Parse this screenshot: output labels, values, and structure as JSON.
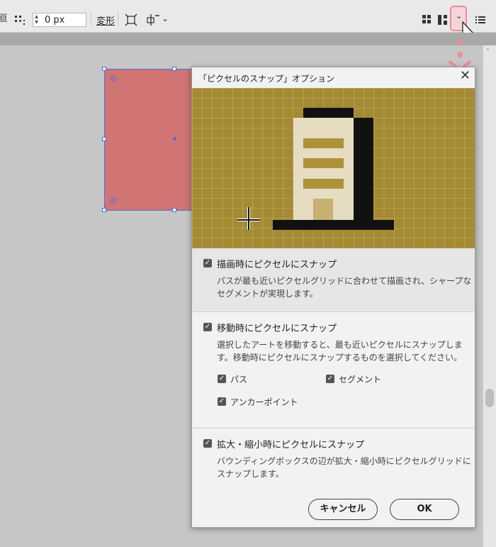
{
  "toolbar": {
    "left_glyph": "亘",
    "pixel_align_icon": "pixel-align-icon",
    "offset_value": "0 px",
    "transform_label": "変形",
    "transform_icon": "transform-bounding-icon",
    "align_icon": "align-anchor-icon",
    "dropdown_chevron": "⌄",
    "grid_icon": "pixel-grid-icon",
    "snap_options_icon": "snap-options-icon",
    "menu_icon": "list-menu-icon",
    "highlight_color": "#ef8b96"
  },
  "canvas": {
    "object_fill": "#d07474",
    "selection_color": "#4a6fd8"
  },
  "dialog": {
    "title": "「ピクセルのスナップ」オプション",
    "close_glyph": "✕",
    "sections": [
      {
        "label": "描画時にピクセルにスナップ",
        "description": "パスが最も近いピクセルグリッドに合わせて描画され、シャープなセグメントが実現します。"
      },
      {
        "label": "移動時にピクセルにスナップ",
        "description": "選択したアートを移動すると、最も近いピクセルにスナップします。移動時にピクセルにスナップするものを選択してください。",
        "options": [
          "パス",
          "セグメント",
          "アンカーポイント"
        ]
      },
      {
        "label": "拡大・縮小時にピクセルにスナップ",
        "description": "バウンディングボックスの辺が拡大・縮小時にピクセルグリッドにスナップします。"
      }
    ],
    "cancel_label": "キャンセル",
    "ok_label": "OK",
    "preview_colors": {
      "background": "#a38a33",
      "grid": "#c9b66f",
      "building": "#e6dcc2",
      "stripes": "#ad9238",
      "outline": "#111111"
    }
  }
}
